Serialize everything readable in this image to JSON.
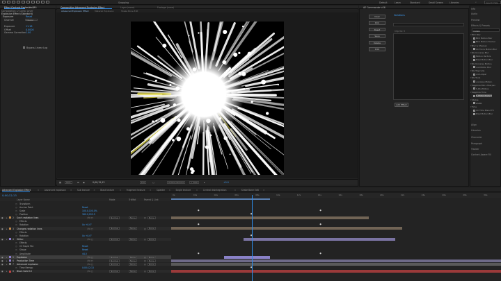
{
  "topbar": {
    "menu_left": "Edit",
    "snapping": "Snapping",
    "workspaces": [
      "Default",
      "Learn",
      "Standard",
      "Small Screen",
      "Libraries"
    ],
    "search_placeholder": "Search Help"
  },
  "left_panel": {
    "tabs": [
      {
        "label": "Effect Controls  Explosion Eff",
        "active": true
      },
      {
        "label": "Project",
        "active": false
      }
    ],
    "comp_line": "Composition: 2 Comp Layer",
    "sections": [
      {
        "label": "Explosion Effect (Standard)",
        "value": ""
      },
      {
        "label": "Exposure",
        "value": "Reset"
      },
      {
        "label": "Channel",
        "value": "Master"
      },
      {
        "label": "Exposure",
        "value": "11.18"
      },
      {
        "label": "Offset",
        "value": "0.0000"
      },
      {
        "label": "Gamma Correction",
        "value": "1.00"
      }
    ],
    "bypass_label": "Bypass Linear Log"
  },
  "comp_panel": {
    "tabs": [
      {
        "label": "Composition  Advanced Explosion Effect",
        "active": true
      },
      {
        "label": "Layer (none)",
        "active": false
      },
      {
        "label": "Footage (none)",
        "active": false
      }
    ],
    "subtabs": [
      "Advanced Explosion Effect",
      "Material Explosion",
      "Shake Bone Edit"
    ],
    "footer": {
      "zoom": "50%",
      "timecode": "0;00;12;13",
      "resolution": "Full",
      "camera": "Active Camera",
      "views": "1 View",
      "exposure": "+0.0"
    }
  },
  "mid_panel": {
    "title": "AE Commander v26",
    "buttons": [
      "Clear",
      "Pick",
      "Reset",
      "Save",
      "Delete",
      "Edit"
    ],
    "preset_tab": "Variations",
    "list_headers": [
      "Clip",
      "Go",
      "5"
    ],
    "ok_button": "Add Effect"
  },
  "right_panel": {
    "sections": [
      "Info",
      "Audio",
      "Preview",
      "Effects & Presets",
      "Align",
      "Libraries",
      "Character",
      "Paragraph",
      "Tracker",
      "Content-Aware Fill"
    ],
    "search_value": "motion",
    "tree": [
      {
        "label": "BCC Blur",
        "indent": 0
      },
      {
        "label": "BCC Motion Blur",
        "indent": 1
      },
      {
        "label": "BCC Motion Tracker",
        "indent": 1
      },
      {
        "label": "Blur & Sharpen",
        "indent": 0
      },
      {
        "label": "CC Force Motion Blur",
        "indent": 1
      },
      {
        "label": "RG Universe Blur",
        "indent": 0
      },
      {
        "label": "Motion Vectors",
        "indent": 1
      },
      {
        "label": "Pixel Motion Blur",
        "indent": 1
      },
      {
        "label": "RG Universe Motion",
        "indent": 0
      },
      {
        "label": "uni.Motion Blur",
        "indent": 1
      },
      {
        "label": "RG Trapcode",
        "indent": 0
      },
      {
        "label": "uni.Looper",
        "indent": 1
      },
      {
        "label": "RG Tools",
        "indent": 0
      },
      {
        "label": "uni.Glow Motion",
        "indent": 1
      },
      {
        "label": "Sapphire Blur+Sharpen",
        "indent": 0
      },
      {
        "label": "S_BlurMotion",
        "indent": 1
      },
      {
        "label": "Sapphire Time",
        "indent": 0
      },
      {
        "label": "S_MotionDetect",
        "indent": 1
      },
      {
        "label": "Stylize",
        "indent": 0
      },
      {
        "label": "RSMB",
        "indent": 1
      },
      {
        "label": "Time",
        "indent": 0
      },
      {
        "label": "CC Time Blend FX",
        "indent": 1
      },
      {
        "label": "Pixel Motion Blur",
        "indent": 1
      }
    ]
  },
  "timeline": {
    "tabs": [
      {
        "label": "Advanced Explosion Effect",
        "active": true
      },
      {
        "label": "Advanced explosion",
        "active": false
      },
      {
        "label": "Sub texture",
        "active": false
      },
      {
        "label": "Blast texture",
        "active": false
      },
      {
        "label": "Fragment texture",
        "active": false
      },
      {
        "label": "Splatter",
        "active": false
      },
      {
        "label": "Single texture",
        "active": false
      },
      {
        "label": "Central disintegration",
        "active": false
      },
      {
        "label": "Shake Bone Edit",
        "active": false
      }
    ],
    "timecode": "0;00;12;13",
    "column_headers": {
      "source": "Layer Name",
      "mode": "Mode",
      "trkmat": "TrkMat",
      "parent": "Parent & Link"
    },
    "ruler": [
      "0s",
      "02s",
      "04s",
      "06s",
      "08s",
      "10s",
      "12s",
      "14s",
      "16s",
      "18s",
      "20s",
      "22s",
      "24s",
      "26s",
      "28s",
      "30s"
    ],
    "rows": [
      {
        "name": "Transform",
        "type": "prop",
        "value": ""
      },
      {
        "name": "Anchor Point",
        "type": "prop",
        "value": "Reset"
      },
      {
        "name": "Scale",
        "type": "prop",
        "value": "100.0,100.0%"
      },
      {
        "name": "Position",
        "type": "prop",
        "value": "360.0,202.5"
      },
      {
        "name": "Sun's radiation lines",
        "type": "layer",
        "num": "2",
        "mode": "Normal",
        "parent": "None",
        "color": "#c58b4b"
      },
      {
        "name": "Effects",
        "type": "prop",
        "value": ""
      },
      {
        "name": "Rotation",
        "type": "prop",
        "value": "0x +0.0°"
      },
      {
        "name": "Changes radiation lines",
        "type": "layer",
        "num": "3",
        "mode": "Normal",
        "parent": "None",
        "color": "#c58b4b"
      },
      {
        "name": "Effects",
        "type": "prop",
        "value": ""
      },
      {
        "name": "Rotation",
        "type": "prop",
        "value": "0x +0.0°"
      },
      {
        "name": "Glitter",
        "type": "layer",
        "num": "4",
        "mode": "Normal",
        "parent": "None",
        "color": "#8f7fd0"
      },
      {
        "name": "Effects",
        "type": "prop",
        "value": ""
      },
      {
        "name": "CC Rapid File",
        "type": "prop",
        "value": "Reset"
      },
      {
        "name": "Shape",
        "type": "prop",
        "value": "Reset"
      },
      {
        "name": "Amplitude",
        "type": "prop",
        "value": "44.0"
      },
      {
        "name": "Explosion",
        "type": "layer",
        "num": "5",
        "mode": "Normal",
        "parent": "None",
        "color": "#8f7fd0",
        "selected": true
      },
      {
        "name": "Production Time",
        "type": "layer",
        "num": "6",
        "mode": "Normal",
        "parent": "None",
        "color": "#8f7fd0"
      },
      {
        "name": "Advanced explosion",
        "type": "layer",
        "num": "7",
        "mode": "Normal",
        "parent": "None",
        "color": "#7a7a7a"
      },
      {
        "name": "Time Remap",
        "type": "prop",
        "value": "0;00;12;13"
      },
      {
        "name": "Black Solid 10",
        "type": "layer",
        "num": "8",
        "mode": "Normal",
        "parent": "None",
        "color": "#c24343"
      }
    ],
    "bars": [
      {
        "row": 4,
        "start": 0.0,
        "end": 0.6,
        "color": "#716455"
      },
      {
        "row": 7,
        "start": 0.0,
        "end": 0.7,
        "color": "#716455"
      },
      {
        "row": 10,
        "start": 0.22,
        "end": 0.68,
        "color": "#7a73a2"
      },
      {
        "row": 15,
        "start": 0.16,
        "end": 0.3,
        "color": "#8a82c8"
      },
      {
        "row": 16,
        "start": 0.0,
        "end": 1.0,
        "color": "#6e6a88"
      },
      {
        "row": 17,
        "start": 0.0,
        "end": 1.0,
        "color": "#5a5a5a"
      },
      {
        "row": 19,
        "start": 0.0,
        "end": 1.0,
        "color": "#9a3a3a"
      }
    ],
    "playhead": 0.245,
    "work_area_end": 0.3
  }
}
